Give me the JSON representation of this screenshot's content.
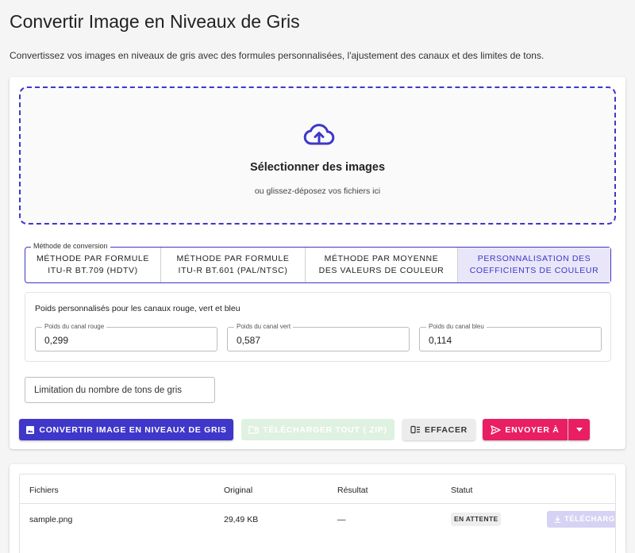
{
  "page": {
    "title": "Convertir Image en Niveaux de Gris",
    "description": "Convertissez vos images en niveaux de gris avec des formules personnalisées, l'ajustement des canaux et des limites de tons."
  },
  "dropzone": {
    "title": "Sélectionner des images",
    "subtitle": "ou glissez-déposez vos fichiers ici"
  },
  "method": {
    "legend": "Méthode de conversion",
    "options": [
      {
        "line1": "MÉTHODE PAR FORMULE",
        "line2": "ITU-R BT.709 (HDTV)"
      },
      {
        "line1": "MÉTHODE PAR FORMULE",
        "line2": "ITU-R BT.601 (PAL/NTSC)"
      },
      {
        "line1": "MÉTHODE PAR MOYENNE",
        "line2": "DES VALEURS DE COULEUR"
      },
      {
        "line1": "PERSONNALISATION DES",
        "line2": "COEFFICIENTS DE COULEUR"
      }
    ],
    "selected_index": 3
  },
  "weights": {
    "title": "Poids personnalisés pour les canaux rouge, vert et bleu",
    "red": {
      "label": "Poids du canal rouge",
      "value": "0,299"
    },
    "green": {
      "label": "Poids du canal vert",
      "value": "0,587"
    },
    "blue": {
      "label": "Poids du canal bleu",
      "value": "0,114"
    }
  },
  "tones": {
    "placeholder": "Limitation du nombre de tons de gris"
  },
  "actions": {
    "convert": "CONVERTIR IMAGE EN NIVEAUX DE GRIS",
    "download_zip": "TÉLÉCHARGER TOUT ( ZIP)",
    "clear": "EFFACER",
    "send": "ENVOYER À"
  },
  "table": {
    "headers": {
      "files": "Fichiers",
      "original": "Original",
      "result": "Résultat",
      "status": "Statut"
    },
    "rows": [
      {
        "file": "sample.png",
        "original": "29,49 KB",
        "result": "—",
        "status": "EN ATTENTE",
        "download": "TÉLÉCHARGER"
      }
    ]
  },
  "colors": {
    "accent": "#3f37c9",
    "send": "#e91e63",
    "zip_disabled": "#dff1e1",
    "download_disabled": "#d6d2f4"
  },
  "icons": {
    "dropzone": "cloud-upload-icon",
    "convert": "image-icon",
    "zip": "folder-zip-icon",
    "clear": "clear-list-icon",
    "send": "send-icon",
    "dropdown": "caret-down-icon",
    "download": "download-icon"
  }
}
